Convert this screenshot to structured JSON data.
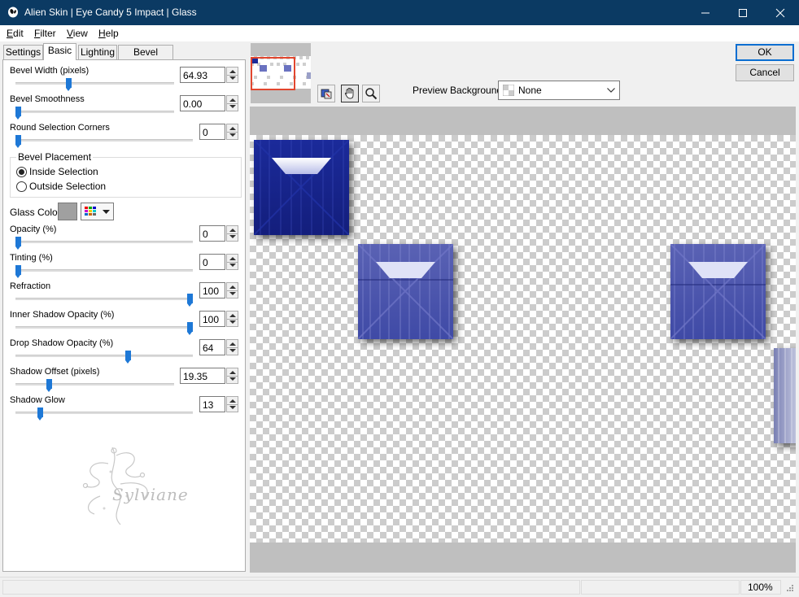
{
  "window": {
    "title": "Alien Skin | Eye Candy 5 Impact | Glass",
    "titlebar_color": "#0b3a63"
  },
  "menu": [
    {
      "mnemonic": "E",
      "rest": "dit"
    },
    {
      "mnemonic": "F",
      "rest": "ilter"
    },
    {
      "mnemonic": "V",
      "rest": "iew"
    },
    {
      "mnemonic": "H",
      "rest": "elp"
    }
  ],
  "tabs": [
    "Settings",
    "Basic",
    "Lighting",
    "Bevel Profile"
  ],
  "active_tab": "Basic",
  "params": [
    {
      "label": "Bevel Width (pixels)",
      "value": "64.93",
      "level": 0.33
    },
    {
      "label": "Bevel Smoothness",
      "value": "0.00",
      "level": 0.0
    },
    {
      "label": "Round Selection Corners",
      "value": "0",
      "level": 0.0
    },
    {
      "label": "Opacity (%)",
      "value": "0",
      "level": 0.0
    },
    {
      "label": "Tinting (%)",
      "value": "0",
      "level": 0.0
    },
    {
      "label": "Refraction",
      "value": "100",
      "level": 1.0
    },
    {
      "label": "Inner Shadow Opacity (%)",
      "value": "100",
      "level": 1.0
    },
    {
      "label": "Drop Shadow Opacity (%)",
      "value": "64",
      "level": 0.64
    },
    {
      "label": "Shadow Offset (pixels)",
      "value": "19.35",
      "level": 0.2
    },
    {
      "label": "Shadow Glow",
      "value": "13",
      "level": 0.13
    }
  ],
  "bevel_placement": {
    "title": "Bevel Placement",
    "options": [
      "Inside Selection",
      "Outside Selection"
    ],
    "selected": "Inside Selection"
  },
  "glass_color": {
    "label": "Glass Color",
    "swatch": "#a0a0a0"
  },
  "watermark": {
    "text": "Sylviane"
  },
  "preview_background": {
    "label": "Preview Background:",
    "value": "None"
  },
  "buttons": {
    "ok": "OK",
    "cancel": "Cancel"
  },
  "status": {
    "zoom": "100%"
  },
  "accent_color": "#1e78d6"
}
